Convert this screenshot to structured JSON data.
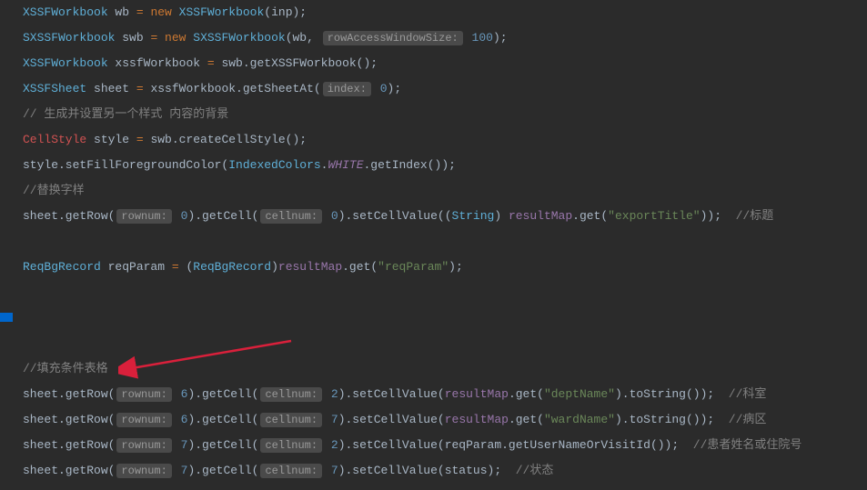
{
  "lines": {
    "l1": {
      "t1": "XSSFWorkbook",
      "v1": " wb ",
      "eq": "=",
      "n": " new ",
      "t2": "XSSFWorkbook",
      "a1": "(inp);"
    },
    "l2": {
      "t1": "SXSSFWorkbook",
      "v1": " swb ",
      "eq": "=",
      "n": " new ",
      "t2": "SXSSFWorkbook",
      "a1": "(wb, ",
      "hint": "rowAccessWindowSize:",
      "num": " 100",
      "a2": ");"
    },
    "l3": {
      "t1": "XSSFWorkbook",
      "v1": " xssfWorkbook ",
      "eq": "=",
      "a1": " swb.getXSSFWorkbook();"
    },
    "l4": {
      "t1": "XSSFSheet",
      "v1": " sheet ",
      "eq": "=",
      "a1": " xssfWorkbook.getSheetAt(",
      "hint": "index:",
      "num": " 0",
      "a2": ");"
    },
    "l5": {
      "c": "// 生成并设置另一个样式 内容的背景"
    },
    "l6": {
      "t1": "CellStyle",
      "v1": " style ",
      "eq": "=",
      "a1": " swb.createCellStyle();"
    },
    "l7": {
      "a1": "style.setFillForegroundColor(",
      "t1": "IndexedColors",
      "p": ".",
      "c1": "WHITE",
      "a2": ".getIndex());"
    },
    "l8": {
      "c": "//替换字样"
    },
    "l9": {
      "a1": "sheet.getRow(",
      "h1": "rownum:",
      "n1": " 0",
      "a2": ").getCell(",
      "h2": "cellnum:",
      "n2": " 0",
      "a3": ").setCellValue((",
      "cast": "String",
      "a4": ") ",
      "r": "resultMap",
      "a5": ".get(",
      "s": "\"exportTitle\"",
      "a6": "));  ",
      "c": "//标题"
    },
    "l10": {
      "t1": "ReqBgRecord",
      "v1": " reqParam ",
      "eq": "=",
      "a1": " (",
      "t2": "ReqBgRecord",
      "a2": ")",
      "r": "resultMap",
      "a3": ".get(",
      "s": "\"reqParam\"",
      "a4": ");"
    },
    "l11": {
      "c": "//填充条件表格"
    },
    "l12": {
      "a1": "sheet.getRow(",
      "h1": "rownum:",
      "n1": " 6",
      "a2": ").getCell(",
      "h2": "cellnum:",
      "n2": " 2",
      "a3": ").setCellValue(",
      "r": "resultMap",
      "a4": ".get(",
      "s": "\"deptName\"",
      "a5": ").toString());  ",
      "c": "//科室"
    },
    "l13": {
      "a1": "sheet.getRow(",
      "h1": "rownum:",
      "n1": " 6",
      "a2": ").getCell(",
      "h2": "cellnum:",
      "n2": " 7",
      "a3": ").setCellValue(",
      "r": "resultMap",
      "a4": ".get(",
      "s": "\"wardName\"",
      "a5": ").toString());  ",
      "c": "//病区"
    },
    "l14": {
      "a1": "sheet.getRow(",
      "h1": "rownum:",
      "n1": " 7",
      "a2": ").getCell(",
      "h2": "cellnum:",
      "n2": " 2",
      "a3": ").setCellValue(reqParam.getUserNameOrVisitId());  ",
      "c": "//患者姓名或住院号"
    },
    "l15": {
      "a1": "sheet.getRow(",
      "h1": "rownum:",
      "n1": " 7",
      "a2": ").getCell(",
      "h2": "cellnum:",
      "n2": " 7",
      "a3": ").setCellValue(status);  ",
      "c": "//状态"
    }
  }
}
